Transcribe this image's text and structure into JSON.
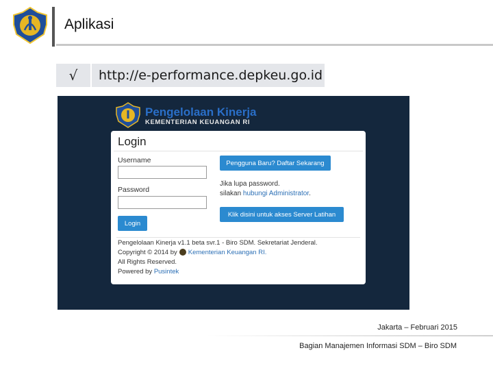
{
  "slide": {
    "title": "Aplikasi",
    "url_check": "√",
    "url": "http://e-performance.depkeu.go.id",
    "date": "Jakarta – Februari 2015",
    "footer": "Bagian Manajemen Informasi SDM – Biro SDM"
  },
  "app": {
    "title": "Pengelolaan Kinerja",
    "subtitle": "KEMENTERIAN KEUANGAN RI",
    "login_heading": "Login",
    "username_label": "Username",
    "username_value": "",
    "password_label": "Password",
    "password_value": "",
    "login_button": "Login",
    "register_button": "Pengguna Baru? Daftar Sekarang",
    "forgot_line1": "Jika lupa password.",
    "forgot_prefix": "silakan ",
    "forgot_link": "hubungi Administrator",
    "forgot_suffix": ".",
    "training_button": "Klik disini untuk akses Server Latihan",
    "footer_line1": "Pengelolaan Kinerja v1.1 beta svr.1 - Biro SDM. Sekretariat Jenderal.",
    "footer_copyright": "Copyright © 2014 by",
    "footer_copyright_link": "Kementerian Keuangan RI.",
    "footer_rights": "All Rights Reserved.",
    "footer_powered": "Powered by",
    "footer_powered_link": "Pusintek"
  },
  "colors": {
    "app_background": "#14273d",
    "brand_blue": "#2a6fc8",
    "button_blue": "#2b8ad0",
    "emblem_gold": "#e6b624",
    "emblem_blue": "#1f4e9a"
  }
}
